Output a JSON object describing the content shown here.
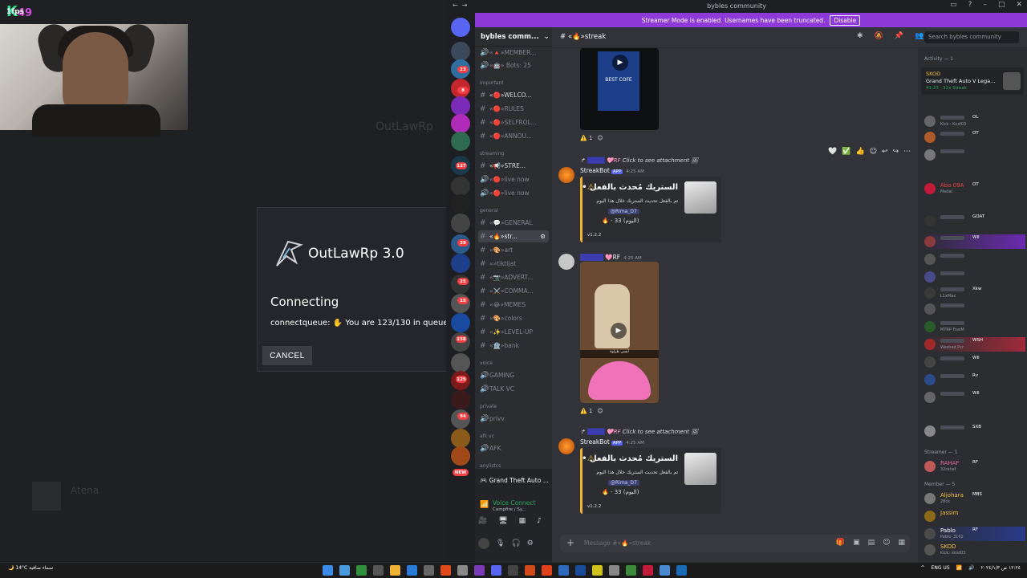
{
  "overlay": {
    "fps_label": "fps",
    "fps_value": "1",
    "fps_count": "49",
    "brand_letter": "K"
  },
  "game": {
    "ghost_title": "OutLawRp",
    "ghost_atena": "Atena",
    "dialog": {
      "title": "OutLawRp 3.0",
      "state": "Connecting",
      "queue_label": "connectqueue:",
      "queue_text": "You are 123/130 in queue",
      "queue_time": "0",
      "cancel": "CANCEL"
    }
  },
  "window": {
    "title": "bybles community"
  },
  "banner": {
    "text": "Streamer Mode is enabled. Usernames have been truncated.",
    "button": "Disable"
  },
  "servers": {
    "badges": [
      "23",
      "8",
      "127",
      "39",
      "25",
      "10",
      "158",
      "125",
      "94",
      "NEW"
    ]
  },
  "sidebar": {
    "guild_name": "bybles comm...",
    "categories": {
      "important": "important",
      "streaming": "streaming",
      "general": "general",
      "voice": "voice",
      "private": "private",
      "afk": "afk vc",
      "anylistcs": "anylistcs"
    },
    "channels": [
      {
        "label": "«🔺»MEMBER...",
        "type": "voice"
      },
      {
        "label": "«🤖» Bots: 25",
        "type": "voice"
      },
      {
        "label": "«🔴»WELCO...",
        "type": "text"
      },
      {
        "label": "«🔴»RULES",
        "type": "text"
      },
      {
        "label": "«🔴»SELFROL...",
        "type": "text"
      },
      {
        "label": "«🔴»ANNOU...",
        "type": "text"
      },
      {
        "label": "«📢»STRE...",
        "type": "text",
        "badge": "1"
      },
      {
        "label": "«🔴»live now",
        "type": "voice",
        "badge": "1"
      },
      {
        "label": "«🔴»live now",
        "type": "voice"
      },
      {
        "label": "«💬»GENERAL",
        "type": "text"
      },
      {
        "label": "«🔥»str...",
        "type": "text"
      },
      {
        "label": "«🎨»art",
        "type": "text"
      },
      {
        "label": "«»tiktijat",
        "type": "text"
      },
      {
        "label": "«📷»ADVERT...",
        "type": "text"
      },
      {
        "label": "«⚔️»COMMA...",
        "type": "text"
      },
      {
        "label": "«😂»MEMES",
        "type": "text"
      },
      {
        "label": "«🎨»colors",
        "type": "text"
      },
      {
        "label": "«✨»LEVEL-UP",
        "type": "text"
      },
      {
        "label": "«🏦»bank",
        "type": "text"
      },
      {
        "label": "GAMING",
        "type": "voice"
      },
      {
        "label": "TALK VC",
        "type": "voice"
      },
      {
        "label": "privv",
        "type": "voice"
      },
      {
        "label": "AFK",
        "type": "voice"
      }
    ],
    "panel": {
      "game": "Grand Theft Auto ...",
      "voice_status": "Voice Connect",
      "voice_sub": "Campfire / Sy..."
    }
  },
  "header": {
    "channel": "«🔥»streak",
    "search_placeholder": "Search bybles community"
  },
  "messages": {
    "reaction_count": "1",
    "reply_text": "Click to see attachment",
    "bot_name": "StreakBot",
    "app_badge": "APP",
    "time1": "4:25 AM",
    "time2": "4:25 AM",
    "time3": "4:25 AM",
    "rf_tag": "RF",
    "embed_title": "الستريك مُحدث بالفعل •",
    "embed_desc": "تم بالفعل تحديث الستريك خلال هذا اليوم",
    "mention": "@Rima_D7",
    "count": "33 (اليوم)",
    "version": "v1.2.2",
    "bag_text": "BEST COFE",
    "video_caption": "أبسي طراوة"
  },
  "composer": {
    "placeholder": "Message #«🔥»streak"
  },
  "members": {
    "activity_header": "Activity — 1",
    "activity": {
      "name": "SKOD",
      "game": "Grand Theft Auto V Lega...",
      "time": "41:23",
      "streak": "32x Streak"
    },
    "cat_streamer": "Streamer — 1",
    "cat_member": "Member — 5",
    "list": [
      {
        "name": "",
        "tag": "OL",
        "color": "#b5bac1",
        "sub": "Kick : Kcxf03"
      },
      {
        "name": "",
        "tag": "OT",
        "color": "#b5bac1",
        "sub": ""
      },
      {
        "name": "",
        "tag": "",
        "color": "#b5bac1",
        "sub": ""
      },
      {
        "name": "Abo 09A",
        "tag": "OT",
        "color": "#e84545",
        "sub": "Medal"
      },
      {
        "name": "",
        "tag": "GOAT",
        "color": "#b5bac1",
        "sub": ""
      },
      {
        "name": "",
        "tag": "WII",
        "color": "#c05cf0",
        "sub": ""
      },
      {
        "name": "",
        "tag": "",
        "color": "#b5bac1",
        "sub": ""
      },
      {
        "name": "",
        "tag": "",
        "color": "#b5bac1",
        "sub": ""
      },
      {
        "name": "",
        "tag": "Xkw",
        "color": "#b5bac1",
        "sub": "L1xMax"
      },
      {
        "name": "",
        "tag": "",
        "color": "#b5bac1",
        "sub": ""
      },
      {
        "name": "",
        "tag": "",
        "color": "#b5bac1",
        "sub": "MTRP FiveM"
      },
      {
        "name": "",
        "tag": "WSH",
        "color": "#e84545",
        "sub": "Washed Pcr"
      },
      {
        "name": "",
        "tag": "WII",
        "color": "#b5bac1",
        "sub": ""
      },
      {
        "name": "",
        "tag": "Rv",
        "color": "#b5bac1",
        "sub": ""
      },
      {
        "name": "",
        "tag": "WII",
        "color": "#b5bac1",
        "sub": ""
      },
      {
        "name": "",
        "tag": "SXB",
        "color": "#b5bac1",
        "sub": ""
      },
      {
        "name": "RAHAF",
        "tag": "RF",
        "color": "#e86aa0",
        "sub": "32rahaf"
      },
      {
        "name": "Aljohara",
        "tag": "MBS",
        "color": "#f0c33c",
        "sub": "28ck"
      },
      {
        "name": "Jassim",
        "tag": "",
        "color": "#f0c33c",
        "sub": ""
      },
      {
        "name": "Pablo",
        "tag": "RF",
        "color": "#ffffff",
        "sub": "Pablo_3162"
      },
      {
        "name": "SKOD",
        "tag": "",
        "color": "#f0c33c",
        "sub": "Kick: skod03"
      }
    ]
  },
  "taskbar": {
    "temp": "14°C",
    "weather_text": "سماء صافية",
    "lang": "ENG",
    "region": "US",
    "time": "١٢:٢٤ ص",
    "date": "٢٠٢٤/١/٣"
  },
  "colors": {
    "accent": "#5865f2",
    "banner": "#8e3ad9",
    "embed_border": "#f0b232",
    "online": "#23a55a"
  }
}
